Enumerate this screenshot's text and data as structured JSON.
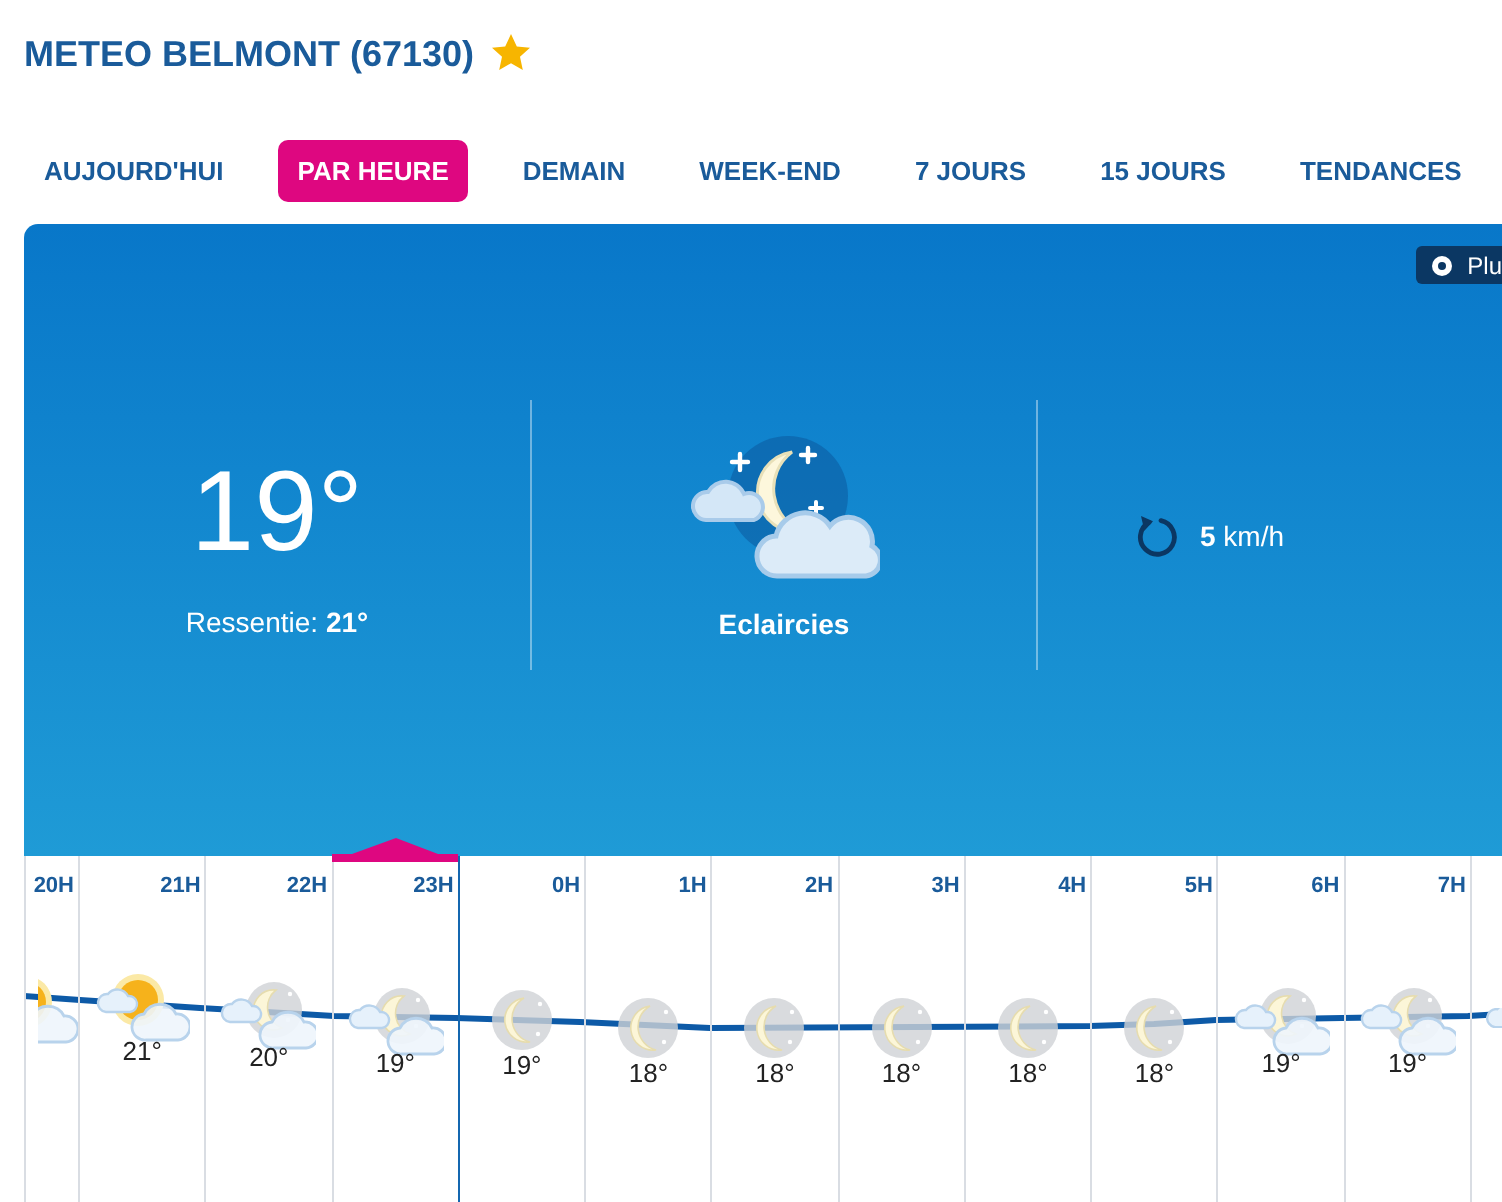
{
  "header": {
    "title": "METEO BELMONT (67130)"
  },
  "tabs": [
    {
      "label": "AUJOURD'HUI",
      "selected": false
    },
    {
      "label": "PAR HEURE",
      "selected": true
    },
    {
      "label": "DEMAIN",
      "selected": false
    },
    {
      "label": "WEEK-END",
      "selected": false
    },
    {
      "label": "7 JOURS",
      "selected": false
    },
    {
      "label": "15 JOURS",
      "selected": false
    },
    {
      "label": "TENDANCES",
      "selected": false
    }
  ],
  "current": {
    "more_button": "Plu",
    "temperature": "19°",
    "feels_like": "Ressentie: **21°**",
    "condition": "Eclaircies",
    "wind": "**5** km/h"
  },
  "hours": [
    {
      "label": "20H",
      "kind": "sun-cloud",
      "selected": false
    },
    {
      "label": "21H",
      "kind": "sun-cloud",
      "temperature": "21°",
      "selected": false
    },
    {
      "label": "22H",
      "kind": "moon-cloud",
      "temperature": "20°",
      "selected": false
    },
    {
      "label": "23H",
      "kind": "moon-cloud",
      "temperature": "19°",
      "selected": true
    },
    {
      "label": "0H",
      "kind": "moon",
      "temperature": "19°",
      "selected": false
    },
    {
      "label": "1H",
      "kind": "moon",
      "temperature": "18°",
      "selected": false
    },
    {
      "label": "2H",
      "kind": "moon",
      "temperature": "18°",
      "selected": false
    },
    {
      "label": "3H",
      "kind": "moon",
      "temperature": "18°",
      "selected": false
    },
    {
      "label": "4H",
      "kind": "moon",
      "temperature": "18°",
      "selected": false
    },
    {
      "label": "5H",
      "kind": "moon",
      "temperature": "18°",
      "selected": false
    },
    {
      "label": "6H",
      "kind": "moon-cloud",
      "temperature": "19°",
      "selected": false
    },
    {
      "label": "7H",
      "kind": "moon-cloud",
      "temperature": "19°",
      "selected": false
    },
    {
      "kind": "moon-cloud",
      "selected": false
    }
  ]
}
